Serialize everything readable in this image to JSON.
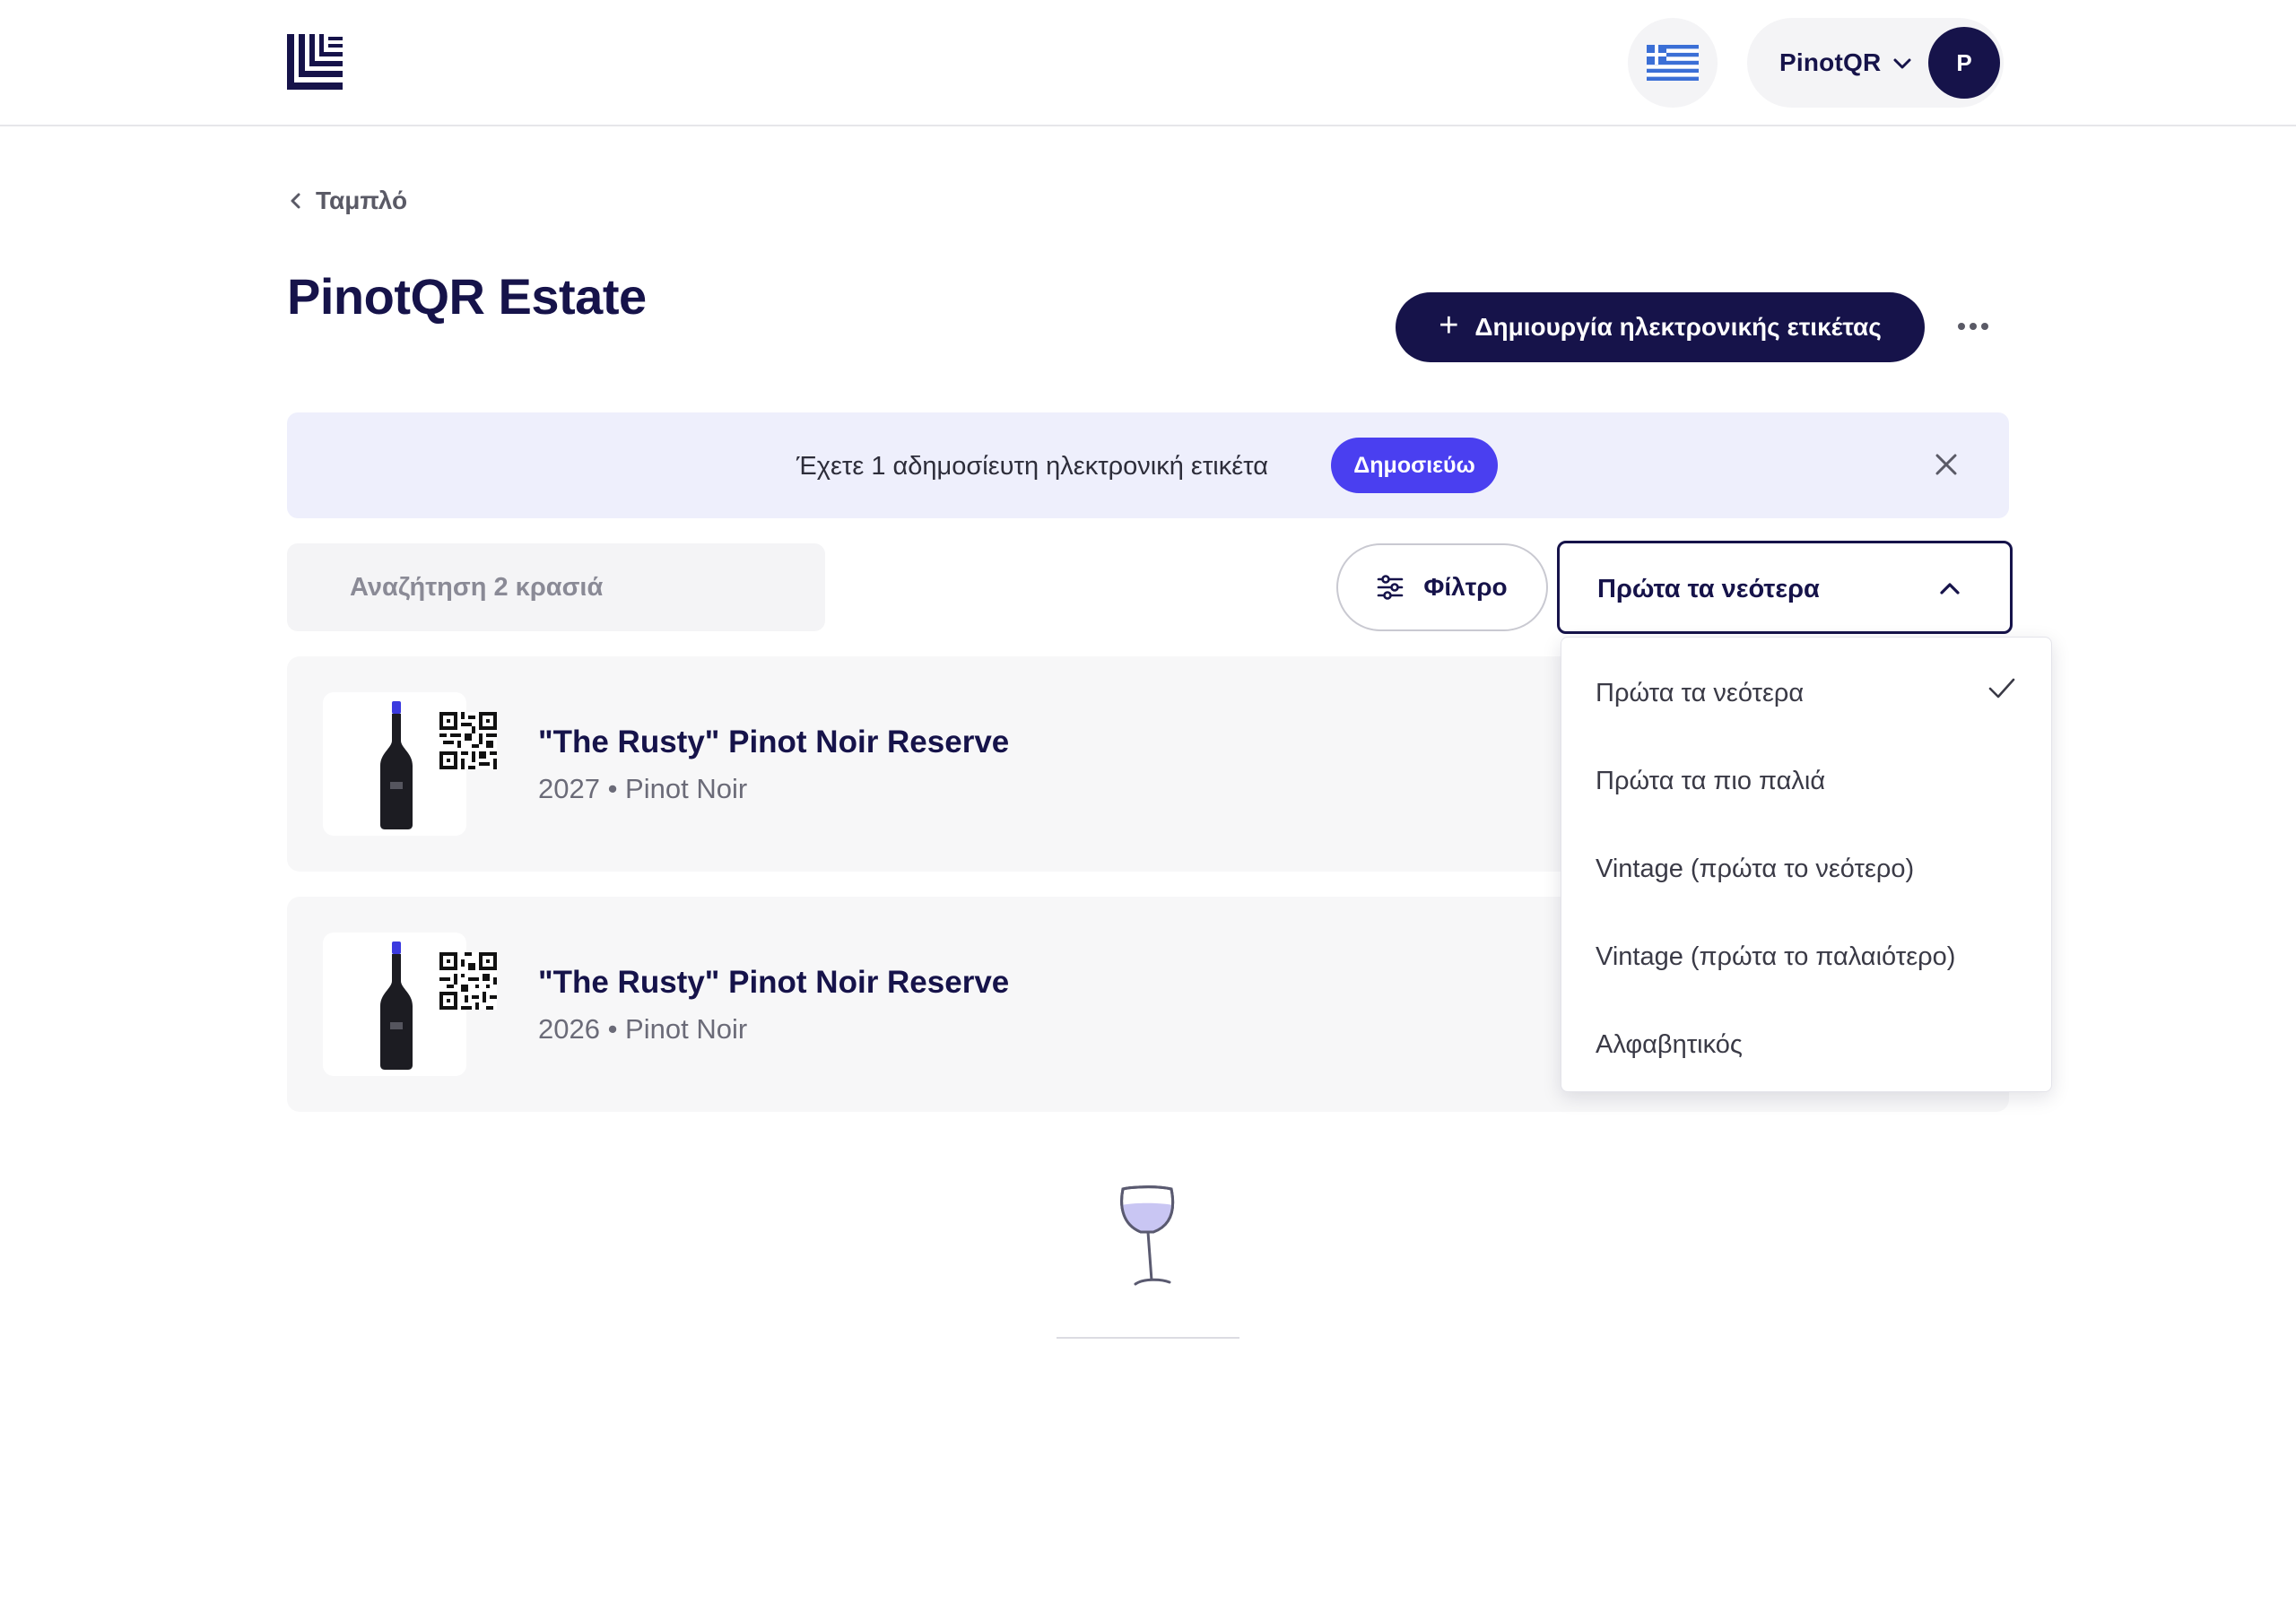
{
  "header": {
    "language_icon": "greek-flag-icon",
    "account_name": "PinotQR",
    "avatar_initial": "P"
  },
  "breadcrumb": {
    "label": "Ταμπλό"
  },
  "page": {
    "title": "PinotQR Estate",
    "create_label": "Δημιουργία ηλεκτρονικής ετικέτας"
  },
  "banner": {
    "text": "Έχετε 1 αδημοσίευτη ηλεκτρονική ετικέτα",
    "publish_label": "Δημοσιεύω"
  },
  "toolbar": {
    "search_placeholder": "Αναζήτηση 2 κρασιά",
    "filter_label": "Φίλτρο",
    "sort_selected": "Πρώτα τα νεότερα"
  },
  "sort_options": [
    "Πρώτα τα νεότερα",
    "Πρώτα τα πιο παλιά",
    "Vintage (πρώτα το νεότερο)",
    "Vintage (πρώτα το παλαιότερο)",
    "Αλφαβητικός"
  ],
  "wines": [
    {
      "name": "\"The Rusty\" Pinot Noir Reserve",
      "meta": "2027 • Pinot Noir"
    },
    {
      "name": "\"The Rusty\" Pinot Noir Reserve",
      "meta": "2026 • Pinot Noir"
    }
  ],
  "colors": {
    "brand_navy": "#16134a",
    "accent_purple": "#4a3ff0",
    "banner_bg": "#eeeffc"
  }
}
